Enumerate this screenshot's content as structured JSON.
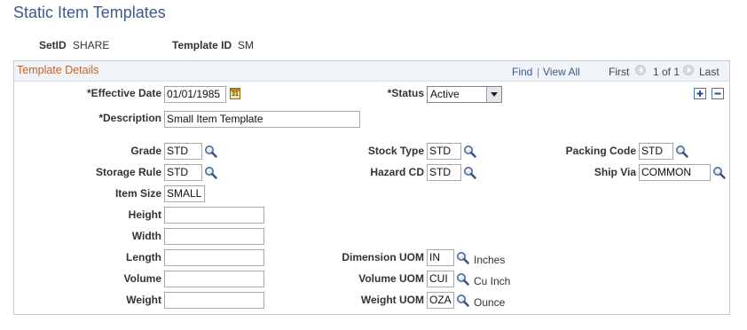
{
  "page": {
    "title": "Static Item Templates"
  },
  "header": {
    "setid_label": "SetID",
    "setid_value": "SHARE",
    "template_label": "Template ID",
    "template_value": "SM"
  },
  "panel": {
    "title": "Template Details",
    "find": "Find",
    "separator": "|",
    "view_all": "View All",
    "first": "First",
    "pager": "1 of 1",
    "last": "Last"
  },
  "fields": {
    "effective_date": {
      "label": "*Effective Date",
      "value": "01/01/1985",
      "calendar_text": "31"
    },
    "status": {
      "label": "*Status",
      "value": "Active"
    },
    "description": {
      "label": "*Description",
      "value": "Small Item Template"
    },
    "grade": {
      "label": "Grade",
      "value": "STD"
    },
    "storage_rule": {
      "label": "Storage Rule",
      "value": "STD"
    },
    "item_size": {
      "label": "Item Size",
      "value": "SMALL"
    },
    "height": {
      "label": "Height",
      "value": ""
    },
    "width": {
      "label": "Width",
      "value": ""
    },
    "length": {
      "label": "Length",
      "value": ""
    },
    "volume": {
      "label": "Volume",
      "value": ""
    },
    "weight": {
      "label": "Weight",
      "value": ""
    },
    "stock_type": {
      "label": "Stock Type",
      "value": "STD"
    },
    "hazard_cd": {
      "label": "Hazard CD",
      "value": "STD"
    },
    "dimension_uom": {
      "label": "Dimension UOM",
      "value": "IN",
      "unit": "Inches"
    },
    "volume_uom": {
      "label": "Volume UOM",
      "value": "CUI",
      "unit": "Cu Inch"
    },
    "weight_uom": {
      "label": "Weight UOM",
      "value": "OZA",
      "unit": "Ounce"
    },
    "packing_code": {
      "label": "Packing Code",
      "value": "STD"
    },
    "ship_via": {
      "label": "Ship Via",
      "value": "COMMON"
    }
  },
  "colors": {
    "title": "#3c5a8a",
    "panel_title": "#c0652a",
    "link": "#3c5a8a",
    "border": "#c5cbd3"
  },
  "icons": [
    "lookup-icon",
    "calendar-icon",
    "prev-icon",
    "next-icon",
    "add-row-icon",
    "delete-row-icon",
    "dropdown-arrow-icon"
  ]
}
